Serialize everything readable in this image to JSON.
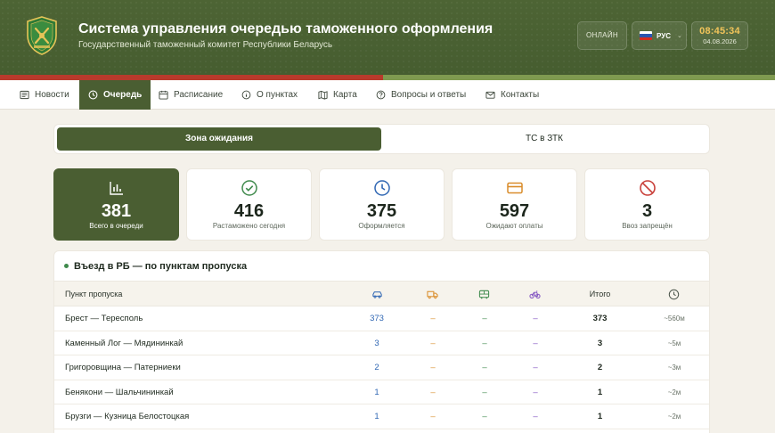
{
  "header": {
    "title": "Система управления очередью таможенного оформления",
    "subtitle": "Государственный таможенный комитет Республики Беларусь",
    "status": "ОНЛАЙН",
    "language": "РУС",
    "time": "08:45:34",
    "date": "04.08.2026"
  },
  "nav": {
    "items": [
      {
        "label": "Новости",
        "icon": "newspaper-icon"
      },
      {
        "label": "Очередь",
        "icon": "clock-icon",
        "active": true
      },
      {
        "label": "Расписание",
        "icon": "calendar-icon"
      },
      {
        "label": "О пунктах",
        "icon": "info-icon"
      },
      {
        "label": "Карта",
        "icon": "map-icon"
      },
      {
        "label": "Вопросы и ответы",
        "icon": "question-icon"
      },
      {
        "label": "Контакты",
        "icon": "mail-icon"
      }
    ]
  },
  "tabs": [
    {
      "label": "Зона ожидания",
      "active": true
    },
    {
      "label": "ТС в ЗТК",
      "active": false
    }
  ],
  "stats": [
    {
      "value": "381",
      "label": "Всего в очереди",
      "icon": "bar-chart-icon"
    },
    {
      "value": "416",
      "label": "Растаможено сегодня",
      "icon": "check-circle-icon"
    },
    {
      "value": "375",
      "label": "Оформляется",
      "icon": "clock-icon"
    },
    {
      "value": "597",
      "label": "Ожидают оплаты",
      "icon": "credit-card-icon"
    },
    {
      "value": "3",
      "label": "Ввоз запрещён",
      "icon": "ban-icon"
    }
  ],
  "table": {
    "title": "Въезд в РБ — по пунктам пропуска",
    "headers": {
      "point": "Пункт пропуска",
      "total": "Итого"
    },
    "column_icons": [
      "car-icon",
      "truck-icon",
      "bus-icon",
      "bicycle-icon",
      "clock-icon"
    ],
    "rows": [
      {
        "point": "Брест — Тересполь",
        "cars": "373",
        "trucks": "–",
        "buses": "–",
        "bikes": "–",
        "total": "373",
        "wait": "~560м"
      },
      {
        "point": "Каменный Лог — Мядининкай",
        "cars": "3",
        "trucks": "–",
        "buses": "–",
        "bikes": "–",
        "total": "3",
        "wait": "~5м"
      },
      {
        "point": "Григоровщина — Патерниеки",
        "cars": "2",
        "trucks": "–",
        "buses": "–",
        "bikes": "–",
        "total": "2",
        "wait": "~3м"
      },
      {
        "point": "Бенякони — Шальчининкай",
        "cars": "1",
        "trucks": "–",
        "buses": "–",
        "bikes": "–",
        "total": "1",
        "wait": "~2м"
      },
      {
        "point": "Брузги — Кузница Белостоцкая",
        "cars": "1",
        "trucks": "–",
        "buses": "–",
        "bikes": "–",
        "total": "1",
        "wait": "~2м"
      }
    ]
  },
  "colors": {
    "brand_green": "#4a5e32",
    "accent_red": "#b83a2c",
    "clock_gold": "#f2c45a",
    "car_blue": "#2f66b3",
    "truck_orange": "#d98c2a",
    "bus_green": "#3f8a4c",
    "bike_purple": "#7f4fc0"
  }
}
